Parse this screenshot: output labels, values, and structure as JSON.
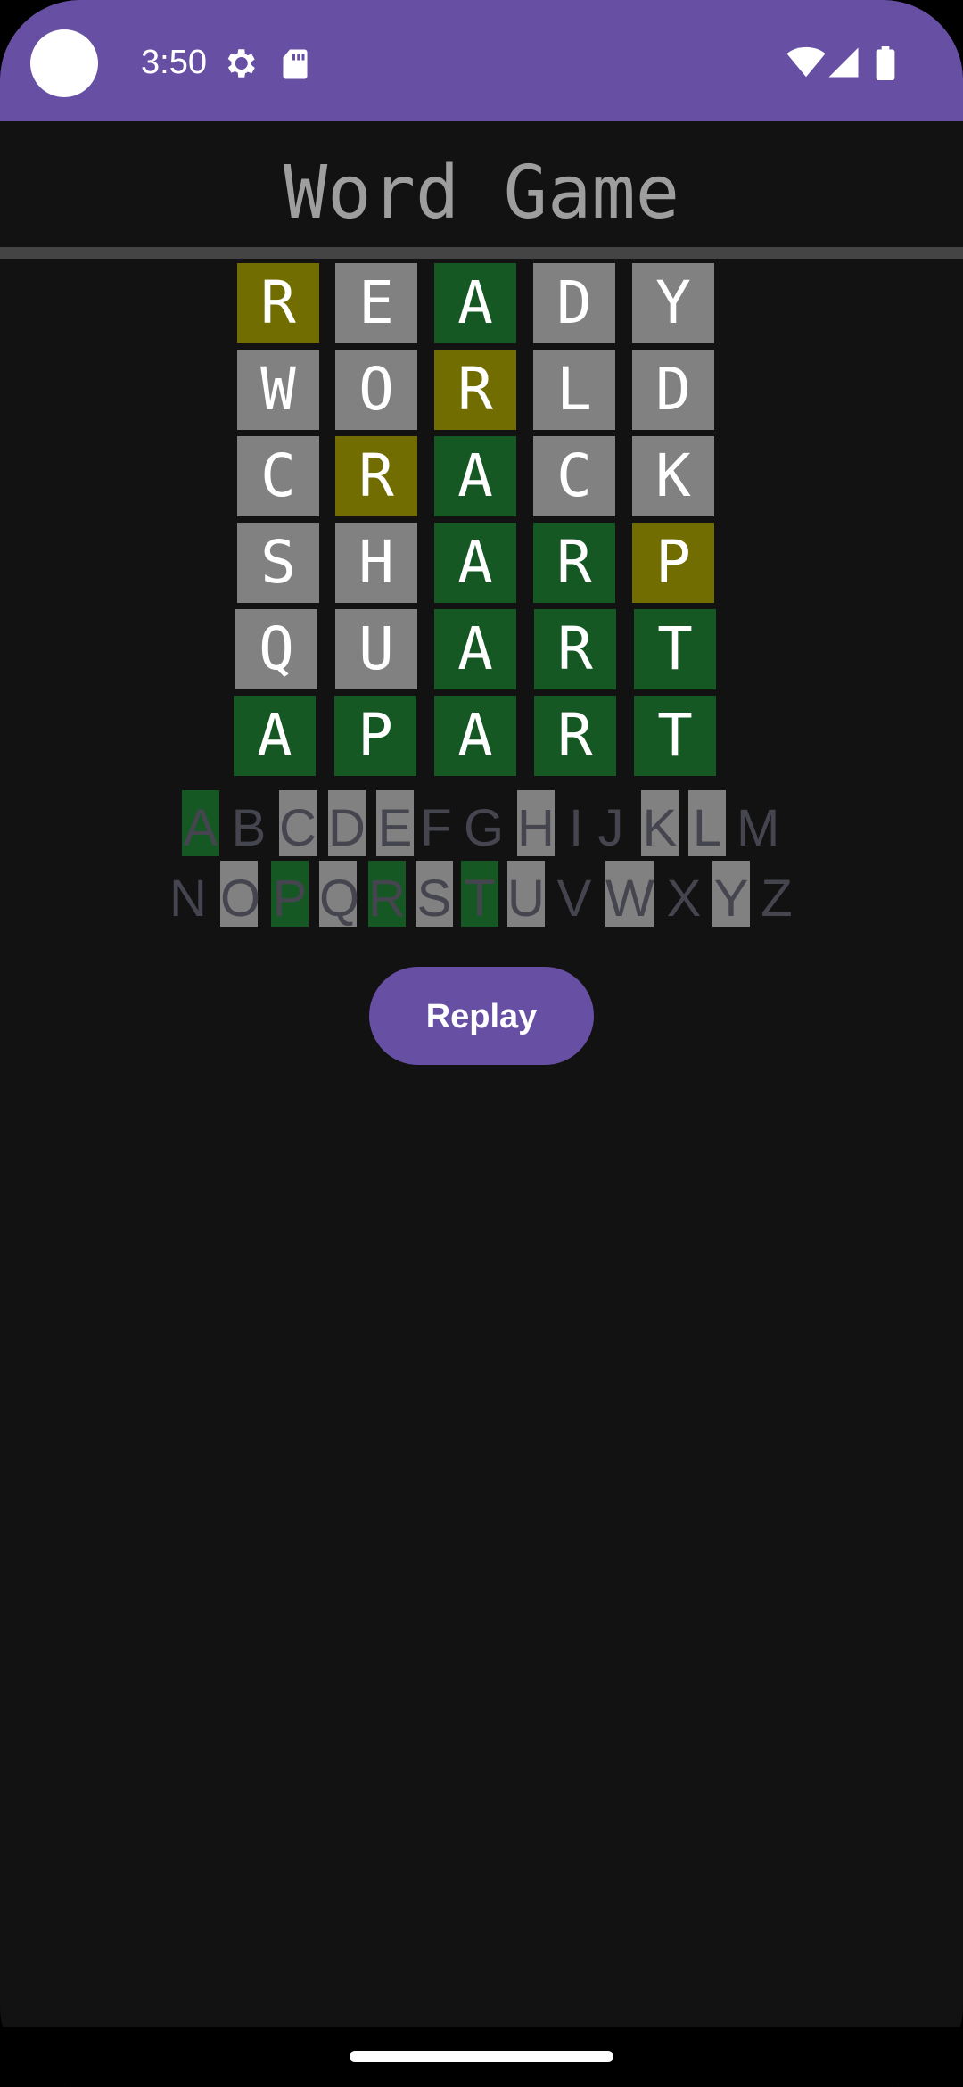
{
  "status_bar": {
    "time": "3:50",
    "icons": [
      "gear-icon",
      "sd-card-icon",
      "wifi-icon",
      "signal-icon",
      "battery-icon"
    ],
    "background": "#6750A4"
  },
  "app": {
    "title": "Word Game"
  },
  "colors": {
    "correct": "#165824",
    "present": "#716d00",
    "absent": "#818181",
    "unused_key_text": "#45454f",
    "accent": "#6750A4"
  },
  "grid": [
    {
      "word": "READY",
      "tiles": [
        {
          "letter": "R",
          "state": "present"
        },
        {
          "letter": "E",
          "state": "absent"
        },
        {
          "letter": "A",
          "state": "correct"
        },
        {
          "letter": "D",
          "state": "absent"
        },
        {
          "letter": "Y",
          "state": "absent"
        }
      ]
    },
    {
      "word": "WORLD",
      "tiles": [
        {
          "letter": "W",
          "state": "absent"
        },
        {
          "letter": "O",
          "state": "absent"
        },
        {
          "letter": "R",
          "state": "present"
        },
        {
          "letter": "L",
          "state": "absent"
        },
        {
          "letter": "D",
          "state": "absent"
        }
      ]
    },
    {
      "word": "CRACK",
      "tiles": [
        {
          "letter": "C",
          "state": "absent"
        },
        {
          "letter": "R",
          "state": "present"
        },
        {
          "letter": "A",
          "state": "correct"
        },
        {
          "letter": "C",
          "state": "absent"
        },
        {
          "letter": "K",
          "state": "absent"
        }
      ]
    },
    {
      "word": "SHARP",
      "tiles": [
        {
          "letter": "S",
          "state": "absent"
        },
        {
          "letter": "H",
          "state": "absent"
        },
        {
          "letter": "A",
          "state": "correct"
        },
        {
          "letter": "R",
          "state": "correct"
        },
        {
          "letter": "P",
          "state": "present"
        }
      ]
    },
    {
      "word": "QUART",
      "tiles": [
        {
          "letter": "Q",
          "state": "absent"
        },
        {
          "letter": "U",
          "state": "absent"
        },
        {
          "letter": "A",
          "state": "correct"
        },
        {
          "letter": "R",
          "state": "correct"
        },
        {
          "letter": "T",
          "state": "correct"
        }
      ]
    },
    {
      "word": "APART",
      "tiles": [
        {
          "letter": "A",
          "state": "correct"
        },
        {
          "letter": "P",
          "state": "correct"
        },
        {
          "letter": "A",
          "state": "correct"
        },
        {
          "letter": "R",
          "state": "correct"
        },
        {
          "letter": "T",
          "state": "correct"
        }
      ]
    }
  ],
  "keyboard": [
    [
      {
        "letter": "A",
        "state": "correct"
      },
      {
        "letter": "B",
        "state": "unused"
      },
      {
        "letter": "C",
        "state": "absent"
      },
      {
        "letter": "D",
        "state": "absent"
      },
      {
        "letter": "E",
        "state": "absent"
      },
      {
        "letter": "F",
        "state": "unused"
      },
      {
        "letter": "G",
        "state": "unused"
      },
      {
        "letter": "H",
        "state": "absent"
      },
      {
        "letter": "I",
        "state": "unused"
      },
      {
        "letter": "J",
        "state": "unused"
      },
      {
        "letter": "K",
        "state": "absent"
      },
      {
        "letter": "L",
        "state": "absent"
      },
      {
        "letter": "M",
        "state": "unused"
      }
    ],
    [
      {
        "letter": "N",
        "state": "unused"
      },
      {
        "letter": "O",
        "state": "absent"
      },
      {
        "letter": "P",
        "state": "correct"
      },
      {
        "letter": "Q",
        "state": "absent"
      },
      {
        "letter": "R",
        "state": "correct"
      },
      {
        "letter": "S",
        "state": "absent"
      },
      {
        "letter": "T",
        "state": "correct"
      },
      {
        "letter": "U",
        "state": "absent"
      },
      {
        "letter": "V",
        "state": "unused"
      },
      {
        "letter": "W",
        "state": "absent"
      },
      {
        "letter": "X",
        "state": "unused"
      },
      {
        "letter": "Y",
        "state": "absent"
      },
      {
        "letter": "Z",
        "state": "unused"
      }
    ]
  ],
  "replay_button": {
    "label": "Replay"
  }
}
